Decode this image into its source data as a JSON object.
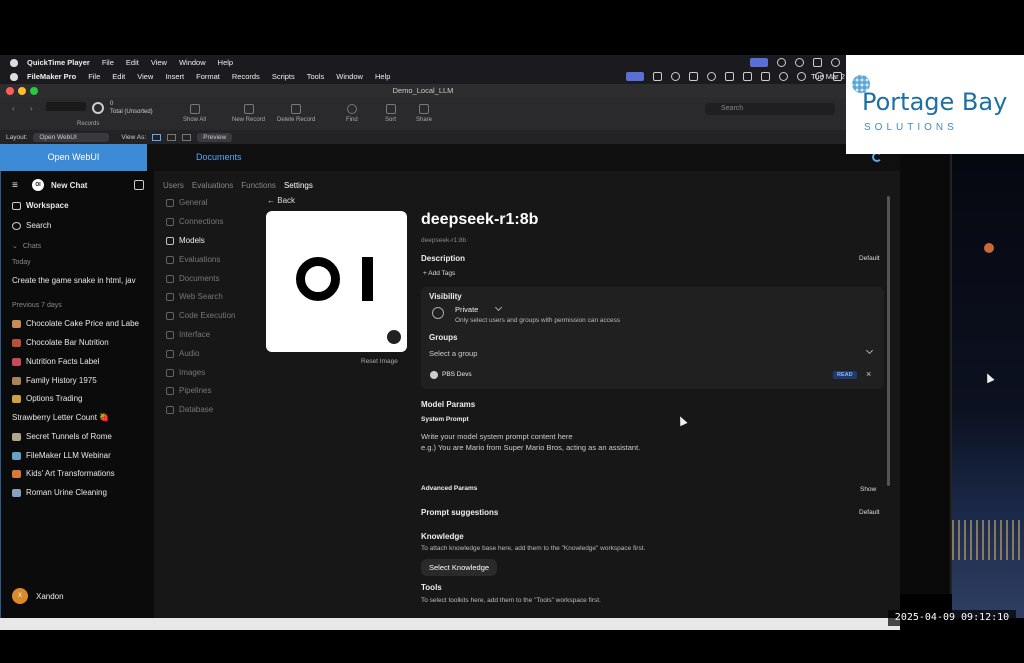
{
  "qt_menubar": {
    "app": "QuickTime Player",
    "items": [
      "File",
      "Edit",
      "View",
      "Window",
      "Help"
    ]
  },
  "fm_menubar": {
    "app": "FileMaker Pro",
    "items": [
      "File",
      "Edit",
      "View",
      "Insert",
      "Format",
      "Records",
      "Scripts",
      "Tools",
      "Window",
      "Help"
    ],
    "clock": "Tue Mar 2"
  },
  "window": {
    "title": "Demo_Local_LLM"
  },
  "toolbar": {
    "records_count": "0",
    "records_total": "Total (Unsorted)",
    "records_label": "Records",
    "show_all": "Show All",
    "new_record": "New Record",
    "delete_record": "Delete Record",
    "find": "Find",
    "sort": "Sort",
    "share": "Share",
    "search_placeholder": "Search"
  },
  "layout_bar": {
    "layout_label": "Layout:",
    "layout_value": "Open WebUI",
    "view_as": "View As:",
    "preview": "Preview"
  },
  "webviewer_tabs": {
    "open_webui": "Open WebUI",
    "documents": "Documents"
  },
  "sidebar": {
    "new_chat": "New Chat",
    "workspace": "Workspace",
    "search": "Search",
    "chats_label": "Chats",
    "today_label": "Today",
    "today_items": [
      "Create the game snake in html, jav"
    ],
    "prev_label": "Previous 7 days",
    "prev_items": [
      {
        "label": "Chocolate Cake Price and Labe",
        "color": "#c98a55"
      },
      {
        "label": "Chocolate Bar Nutrition",
        "color": "#b8503a"
      },
      {
        "label": "Nutrition Facts Label",
        "color": "#c74a5a"
      },
      {
        "label": "Family History 1975",
        "color": "#a8845c"
      },
      {
        "label": "Options Trading",
        "color": "#d0a040"
      },
      {
        "label": "Strawberry Letter Count 🍓",
        "color": ""
      },
      {
        "label": "Secret Tunnels of Rome",
        "color": "#b0a68a"
      },
      {
        "label": "FileMaker LLM Webinar",
        "color": "#6aa0c8"
      },
      {
        "label": "Kids' Art Transformations",
        "color": "#d67a3a"
      },
      {
        "label": "Roman Urine Cleaning",
        "color": "#8aa0c0"
      }
    ],
    "user": "Xandon",
    "user_initial": "X"
  },
  "settings_tabs": [
    "Users",
    "Evaluations",
    "Functions",
    "Settings"
  ],
  "settings_nav": [
    "General",
    "Connections",
    "Models",
    "Evaluations",
    "Documents",
    "Web Search",
    "Code Execution",
    "Interface",
    "Audio",
    "Images",
    "Pipelines",
    "Database"
  ],
  "model": {
    "back": "Back",
    "name": "deepseek-r1:8b",
    "id": "deepseek-r1:8b",
    "reset_image": "Reset Image",
    "description_label": "Description",
    "description_value": "Default",
    "add_tags": "Add Tags",
    "visibility_label": "Visibility",
    "visibility_value": "Private",
    "visibility_help": "Only select users and groups with permission can access",
    "groups_label": "Groups",
    "group_placeholder": "Select a group",
    "group_name": "PBS Devs",
    "group_permission": "READ",
    "model_params": "Model Params",
    "system_prompt_label": "System Prompt",
    "system_prompt_line1": "Write your model system prompt content here",
    "system_prompt_line2": "e.g.) You are Mario from Super Mario Bros, acting as an assistant.",
    "advanced_params": "Advanced Params",
    "advanced_show": "Show",
    "prompt_suggestions": "Prompt suggestions",
    "prompt_suggestions_value": "Default",
    "knowledge_label": "Knowledge",
    "knowledge_help": "To attach knowledge base here, add them to the \"Knowledge\" workspace first.",
    "select_knowledge": "Select Knowledge",
    "tools_label": "Tools",
    "tools_help": "To select toolkits here, add them to the \"Tools\" workspace first."
  },
  "logo": {
    "main": "Portage Bay",
    "sub": "SOLUTIONS"
  },
  "timestamp": "2025-04-09  09:12:10"
}
